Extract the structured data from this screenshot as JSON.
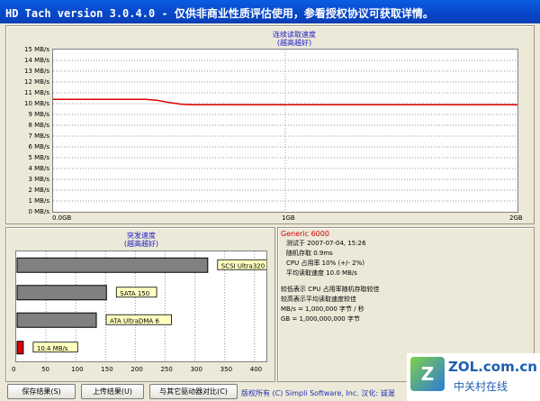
{
  "window": {
    "title": "HD Tach version 3.0.4.0  - 仅供非商业性质评估使用，参看授权协议可获取详情。"
  },
  "seq_chart": {
    "title_line1": "连续读取速度",
    "title_line2": "(越高越好)",
    "y_ticks": [
      "15 MB/s",
      "14 MB/s",
      "13 MB/s",
      "12 MB/s",
      "11 MB/s",
      "10 MB/s",
      "9 MB/s",
      "8 MB/s",
      "7 MB/s",
      "6 MB/s",
      "5 MB/s",
      "4 MB/s",
      "3 MB/s",
      "2 MB/s",
      "1 MB/s",
      "0 MB/s"
    ],
    "x_ticks": [
      "0.0GB",
      "1GB",
      "2GB"
    ]
  },
  "chart_data": [
    {
      "type": "line",
      "title": "连续读取速度 (越高越好)",
      "ylim": [
        0,
        15
      ],
      "xlim": [
        0,
        2
      ],
      "x_tick_labels": [
        "0.0GB",
        "1GB",
        "2GB"
      ],
      "y_unit": "MB/s",
      "grid": true,
      "series": [
        {
          "color": "#e00000",
          "x": [
            0,
            0.2,
            0.4,
            0.45,
            0.5,
            0.55,
            0.6,
            0.75,
            1.0,
            1.5,
            2.0
          ],
          "y": [
            10.4,
            10.4,
            10.4,
            10.3,
            10.1,
            9.95,
            9.9,
            9.9,
            9.9,
            9.9,
            9.9
          ]
        }
      ]
    },
    {
      "type": "bar",
      "title": "突发速度 (越高越好)",
      "orientation": "horizontal",
      "xlim": [
        0,
        420
      ],
      "x_ticks": [
        0,
        50,
        100,
        150,
        200,
        250,
        300,
        350,
        400
      ],
      "grid": true,
      "bars": [
        {
          "label": "SCSI Ultra320",
          "value": 320,
          "color": "#808080"
        },
        {
          "label": "SATA 150",
          "value": 150,
          "color": "#808080"
        },
        {
          "label": "ATA UltraDMA 6",
          "value": 133,
          "color": "#808080"
        },
        {
          "label": "10.4 MB/s",
          "value": 10.4,
          "color": "#e00000"
        }
      ]
    }
  ],
  "burst_chart": {
    "title_line1": "突发速度",
    "title_line2": "(越高越好)"
  },
  "info": {
    "drive_name": "Generic 6000",
    "lines": [
      "测试于 2007-07-04, 15:26",
      "随机存取 0.9ms",
      "CPU 占用率 10% (+/- 2%)",
      "平均读取速度 10.0 MB/s"
    ],
    "legend_lines": [
      "较低表示 CPU 占用率随机存取较佳",
      "较高表示平均读取速度较佳",
      "MB/s = 1,000,000 字节 / 秒",
      "GB = 1,000,000,000 字节"
    ]
  },
  "buttons": {
    "save": "保存结果(S)",
    "upload": "上传结果(U)",
    "compare": "与其它驱动器对比(C)"
  },
  "footer": "版权所有 (C) Simpli Software, Inc. 汉化: 诚渥",
  "watermark": {
    "brand": "ZOL.com.cn",
    "sub": "中关村在线"
  }
}
